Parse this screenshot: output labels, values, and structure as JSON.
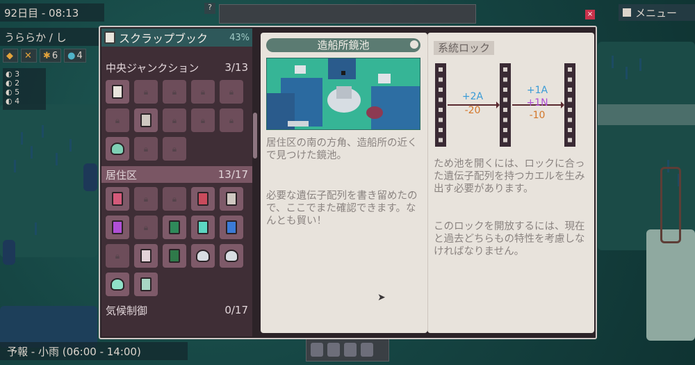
{
  "hud": {
    "day": "92日目 - 08:13",
    "weather": "うららか / し",
    "resources": [
      {
        "icon": "coin-icon",
        "glyph": "◆",
        "value": ""
      },
      {
        "icon": "tool-icon",
        "glyph": "✕",
        "value": ""
      },
      {
        "icon": "gear-icon",
        "glyph": "✱",
        "value": "6"
      },
      {
        "icon": "drop-icon",
        "glyph": "●",
        "value": "4"
      }
    ],
    "stats": [
      "3",
      "2",
      "5",
      "4"
    ],
    "menu_label": "メニュー",
    "help": "?",
    "forecast": "予報 - 小雨 (06:00 - 14:00)"
  },
  "close_label": "×",
  "scrapbook": {
    "title": "スクラップブック",
    "percent": "43%",
    "categories": [
      {
        "name": "中央ジャンクション",
        "count": "3/13"
      },
      {
        "name": "居住区",
        "count": "13/17"
      },
      {
        "name": "気候制御",
        "count": "0/17"
      }
    ],
    "grid1_items": [
      "gate",
      "lock",
      "lock",
      "lock",
      "lock",
      "lock",
      "sign",
      "lock",
      "lock",
      "lock",
      "frog",
      "lock",
      "lock"
    ],
    "grid2_items": [
      "radio",
      "lock",
      "lock",
      "book-red",
      "phone",
      "book-purple",
      "lock",
      "book-green",
      "book-teal",
      "book-blue",
      "lock",
      "frame",
      "book-darkgreen",
      "frog-white",
      "frog-white",
      "frog-teal",
      "crate"
    ]
  },
  "entry": {
    "title": "造船所鏡池",
    "description_1": "居住区の南の方角、造船所の近くで見つけた鏡池。",
    "description_2": "必要な遺伝子配列を書き留めたので、ここでまた確認できます。なんとも貿い！"
  },
  "lock": {
    "tag": "系統ロック",
    "diagram": {
      "step1": [
        "+2A",
        "-20"
      ],
      "step2": [
        "+1A",
        "+1N",
        "-10"
      ],
      "colors": {
        "A": "#3a9bd6",
        "O": "#d3772a",
        "N": "#b04fd6"
      }
    },
    "info_1": "ため池を開くには、ロックに合った遺伝子配列を持つカエルを生み出す必要があります。",
    "info_2": "このロックを開放するには、現在と過去どちらもの特性を考慮しなければなりません。"
  }
}
